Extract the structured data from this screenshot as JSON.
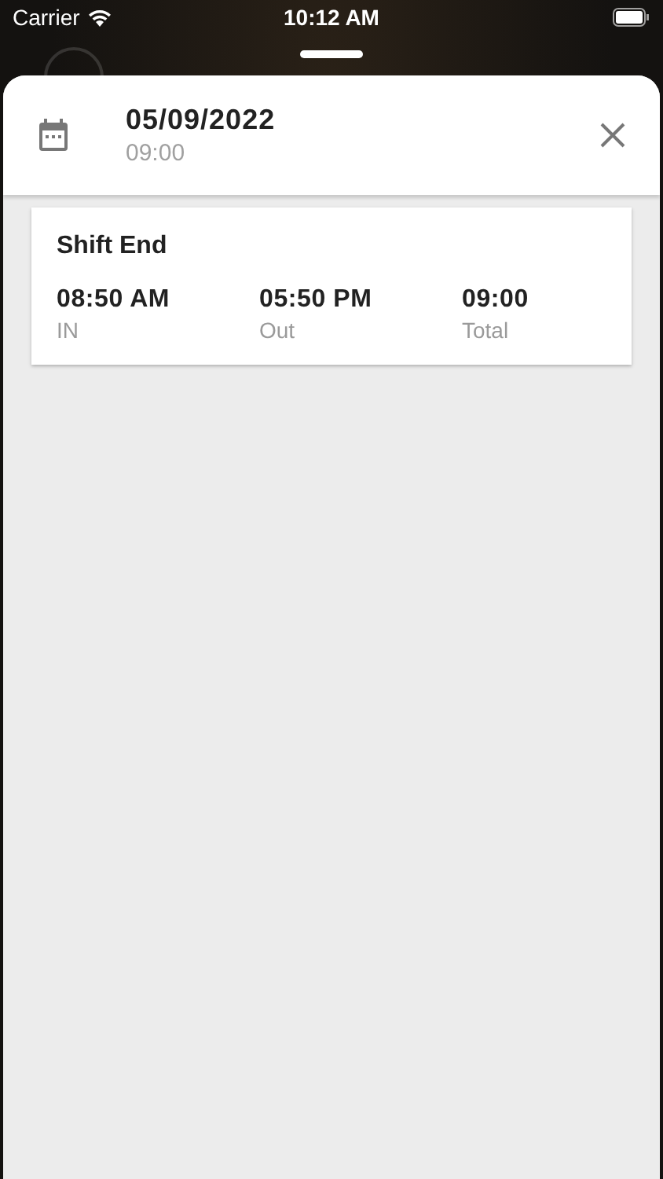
{
  "status_bar": {
    "carrier": "Carrier",
    "time": "10:12 AM"
  },
  "header": {
    "date": "05/09/2022",
    "hours": "09:00"
  },
  "entries": [
    {
      "title": "Shift End",
      "fields": [
        {
          "value": "08:50 AM",
          "label": "IN"
        },
        {
          "value": "05:50 PM",
          "label": "Out"
        },
        {
          "value": "09:00",
          "label": "Total"
        }
      ]
    }
  ]
}
